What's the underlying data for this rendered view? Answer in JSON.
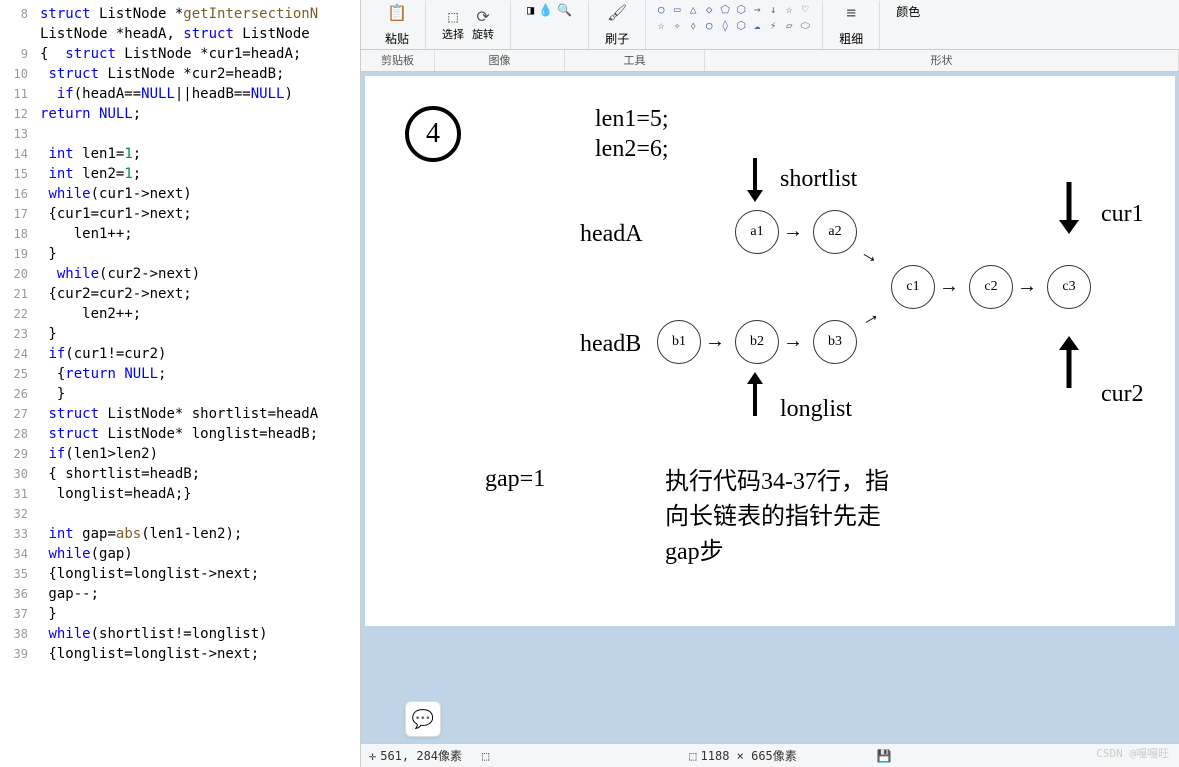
{
  "code": {
    "lines": [
      {
        "n": 8,
        "html": "<span class='kw'>struct</span> ListNode *<span class='fn'>getIntersectionN</span>"
      },
      {
        "n": "",
        "html": "ListNode *headA, <span class='kw'>struct</span> ListNode "
      },
      {
        "n": 9,
        "html": "{  <span class='kw'>struct</span> ListNode *cur1=headA;"
      },
      {
        "n": 10,
        "html": " <span class='kw'>struct</span> ListNode *cur2=headB;"
      },
      {
        "n": 11,
        "html": "  <span class='kw'>if</span>(headA==<span class='const'>NULL</span>||headB==<span class='const'>NULL</span>)"
      },
      {
        "n": 12,
        "html": "<span class='kw'>return</span> <span class='const'>NULL</span>;"
      },
      {
        "n": 13,
        "html": ""
      },
      {
        "n": 14,
        "html": " <span class='kw'>int</span> len1=<span class='num'>1</span>;"
      },
      {
        "n": 15,
        "html": " <span class='kw'>int</span> len2=<span class='num'>1</span>;"
      },
      {
        "n": 16,
        "html": " <span class='kw'>while</span>(cur1-&gt;next)"
      },
      {
        "n": 17,
        "html": " {cur1=cur1-&gt;next;"
      },
      {
        "n": 18,
        "html": "    len1++;"
      },
      {
        "n": 19,
        "html": " }"
      },
      {
        "n": 20,
        "html": "  <span class='kw'>while</span>(cur2-&gt;next)"
      },
      {
        "n": 21,
        "html": " {cur2=cur2-&gt;next;"
      },
      {
        "n": 22,
        "html": "     len2++;"
      },
      {
        "n": 23,
        "html": " }"
      },
      {
        "n": 24,
        "html": " <span class='kw'>if</span>(cur1!=cur2)"
      },
      {
        "n": 25,
        "html": "  {<span class='kw'>return</span> <span class='const'>NULL</span>;"
      },
      {
        "n": 26,
        "html": "  }"
      },
      {
        "n": 27,
        "html": " <span class='kw'>struct</span> ListNode* shortlist=headA"
      },
      {
        "n": 28,
        "html": " <span class='kw'>struct</span> ListNode* longlist=headB;"
      },
      {
        "n": 29,
        "html": " <span class='kw'>if</span>(len1&gt;len2)"
      },
      {
        "n": 30,
        "html": " { shortlist=headB;"
      },
      {
        "n": 31,
        "html": "  longlist=headA;}"
      },
      {
        "n": 32,
        "html": ""
      },
      {
        "n": 33,
        "html": " <span class='kw'>int</span> gap=<span class='fn'>abs</span>(len1-len2);"
      },
      {
        "n": 34,
        "html": " <span class='kw'>while</span>(gap)"
      },
      {
        "n": 35,
        "html": " {longlist=longlist-&gt;next;"
      },
      {
        "n": 36,
        "html": " gap--;"
      },
      {
        "n": 37,
        "html": " }"
      },
      {
        "n": 38,
        "html": " <span class='kw'>while</span>(shortlist!=longlist)"
      },
      {
        "n": 39,
        "html": " {longlist=longlist-&gt;next;"
      }
    ]
  },
  "ribbon": {
    "paste": "粘贴",
    "select": "选择",
    "rotate": "旋转",
    "brush": "刷子",
    "thick": "粗细",
    "color": "颜色",
    "groups": {
      "clipboard": "剪贴板",
      "image": "图像",
      "tools": "工具",
      "shapes": "形状"
    }
  },
  "diagram": {
    "step": "4",
    "len1": "len1=5;",
    "len2": "len2=6;",
    "shortlist": "shortlist",
    "longlist": "longlist",
    "cur1": "cur1",
    "cur2": "cur2",
    "headA": "headA",
    "headB": "headB",
    "gap": "gap=1",
    "note1": "执行代码34-37行，指",
    "note2": "向长链表的指针先走",
    "note3": "gap步",
    "nodes": {
      "a1": "a1",
      "a2": "a2",
      "b1": "b1",
      "b2": "b2",
      "b3": "b3",
      "c1": "c1",
      "c2": "c2",
      "c3": "c3"
    }
  },
  "status": {
    "coords": "561, 284像素",
    "size": "1188 × 665像素"
  },
  "watermark": "CSDN @嘎嘎旺"
}
